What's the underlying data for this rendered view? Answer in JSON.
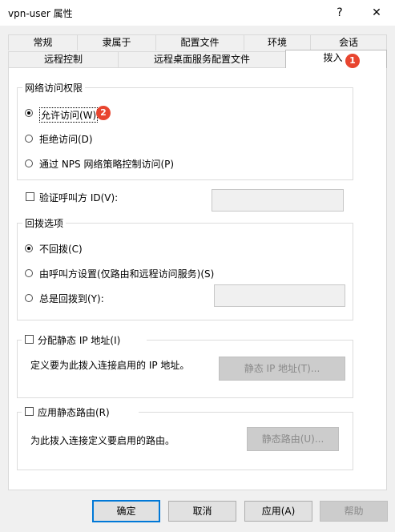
{
  "window": {
    "title": "vpn-user 属性",
    "help_glyph": "?",
    "close_glyph": "✕"
  },
  "tabs": {
    "row1": [
      "常规",
      "隶属于",
      "配置文件",
      "环境",
      "会话"
    ],
    "row2": [
      "远程控制",
      "远程桌面服务配置文件",
      "拨入"
    ]
  },
  "badges": {
    "tab": "1",
    "radio": "2"
  },
  "network_access": {
    "legend": "网络访问权限",
    "options": [
      "允许访问(W)",
      "拒绝访问(D)",
      "通过 NPS 网络策略控制访问(P)"
    ],
    "selected": 0
  },
  "verify_caller_id": {
    "label": "验证呼叫方 ID(V):",
    "checked": false,
    "value": ""
  },
  "callback": {
    "legend": "回拨选项",
    "options": [
      "不回拨(C)",
      "由呼叫方设置(仅路由和远程访问服务)(S)",
      "总是回拨到(Y):"
    ],
    "selected": 0,
    "number": ""
  },
  "static_ip": {
    "label": "分配静态 IP 地址(I)",
    "desc": "定义要为此拨入连接启用的 IP 地址。",
    "button": "静态 IP 地址(T)...",
    "checked": false
  },
  "static_routes": {
    "label": "应用静态路由(R)",
    "desc": "为此拨入连接定义要启用的路由。",
    "button": "静态路由(U)...",
    "checked": false
  },
  "buttons": {
    "ok": "确定",
    "cancel": "取消",
    "apply": "应用(A)",
    "help": "帮助"
  },
  "colors": {
    "accent": "#0078d7",
    "badge": "#e8452f"
  }
}
